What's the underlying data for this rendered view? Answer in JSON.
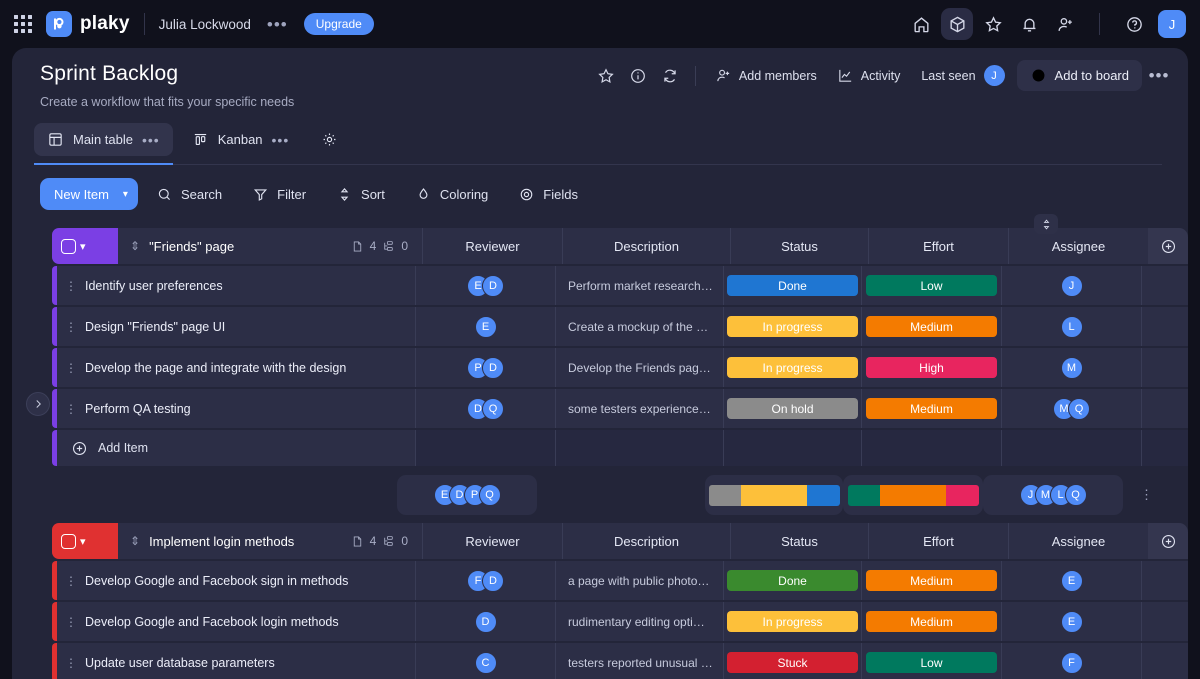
{
  "topnav": {
    "apps_icon": "grid-apps-icon",
    "logo_text": "plaky",
    "user_name": "Julia Lockwood",
    "more_label": "•••",
    "upgrade_label": "Upgrade",
    "icons": [
      "home-icon",
      "cube-icon",
      "star-icon",
      "bell-icon",
      "add-user-icon",
      "help-icon"
    ],
    "avatar_initial": "J",
    "accent": "#4f8bf7"
  },
  "board": {
    "title": "Sprint Backlog",
    "subtitle": "Create a workflow that fits your specific needs",
    "actions": {
      "star": "star-icon",
      "info": "info-icon",
      "refresh": "activity-refresh-icon",
      "add_members": "Add members",
      "activity": "Activity",
      "last_seen": "Last seen",
      "last_seen_avatar": "J",
      "add_to_board": "Add to board",
      "more": "•••"
    },
    "tabs": [
      {
        "label": "Main table",
        "icon": "table-icon",
        "selected": true,
        "menu": "•••"
      },
      {
        "label": "Kanban",
        "icon": "kanban-icon",
        "selected": false,
        "menu": "•••"
      }
    ],
    "settings_icon": "gear-icon"
  },
  "toolbar": {
    "new_item": "New Item",
    "new_item_caret": "▾",
    "buttons": [
      {
        "label": "Search",
        "icon": "search-icon"
      },
      {
        "label": "Filter",
        "icon": "filter-icon"
      },
      {
        "label": "Sort",
        "icon": "sort-icon"
      },
      {
        "label": "Coloring",
        "icon": "coloring-drop-icon"
      },
      {
        "label": "Fields",
        "icon": "eye-fields-icon"
      }
    ],
    "sort_toggle_icon": "sort-updown-icon"
  },
  "columns": [
    "Reviewer",
    "Description",
    "Status",
    "Effort",
    "Assignee"
  ],
  "add_item_label": "Add Item",
  "groups": [
    {
      "title": "\"Friends\" page",
      "color": "#7b3fe4",
      "badge_color": "#7b3fe4",
      "doc_count": "4",
      "sub_count": "0",
      "rows": [
        {
          "name": "Identify user preferences",
          "reviewers": [
            "E",
            "D"
          ],
          "description": "Perform market research…",
          "status": {
            "label": "Done",
            "color": "#1f76d2"
          },
          "effort": {
            "label": "Low",
            "color": "#00795e"
          },
          "assignees": [
            "J"
          ]
        },
        {
          "name": "Design \"Friends\" page UI",
          "reviewers": [
            "E"
          ],
          "description": "Create a mockup of the …",
          "status": {
            "label": "In progress",
            "color": "#fdc03a"
          },
          "effort": {
            "label": "Medium",
            "color": "#f47b00"
          },
          "assignees": [
            "L"
          ]
        },
        {
          "name": "Develop the page and integrate with the design",
          "reviewers": [
            "P",
            "D"
          ],
          "description": "Develop the Friends pag…",
          "status": {
            "label": "In progress",
            "color": "#fdc03a"
          },
          "effort": {
            "label": "High",
            "color": "#e8255f"
          },
          "assignees": [
            "M"
          ]
        },
        {
          "name": "Perform QA testing",
          "reviewers": [
            "D",
            "Q"
          ],
          "description": "some testers experience…",
          "status": {
            "label": "On hold",
            "color": "#8b8b8b"
          },
          "effort": {
            "label": "Medium",
            "color": "#f47b00"
          },
          "assignees": [
            "M",
            "Q"
          ]
        }
      ],
      "summary": {
        "reviewers": [
          "E",
          "D",
          "P",
          "Q"
        ],
        "status_stack": [
          {
            "color": "#8b8b8b",
            "pct": 25
          },
          {
            "color": "#fdc03a",
            "pct": 50
          },
          {
            "color": "#1f76d2",
            "pct": 25
          }
        ],
        "effort_stack": [
          {
            "color": "#00795e",
            "pct": 25
          },
          {
            "color": "#f47b00",
            "pct": 50
          },
          {
            "color": "#e8255f",
            "pct": 25
          }
        ],
        "assignees": [
          "J",
          "M",
          "L",
          "Q"
        ],
        "more": "⋮"
      }
    },
    {
      "title": "Implement login methods",
      "color": "#e03131",
      "badge_color": "#e03131",
      "doc_count": "4",
      "sub_count": "0",
      "rows": [
        {
          "name": "Develop Google and Facebook sign in methods",
          "reviewers": [
            "F",
            "D"
          ],
          "description": "a page with public photo…",
          "status": {
            "label": "Done",
            "color": "#3a8a2e"
          },
          "effort": {
            "label": "Medium",
            "color": "#f47b00"
          },
          "assignees": [
            "E"
          ]
        },
        {
          "name": "Develop Google and Facebook login methods",
          "reviewers": [
            "D"
          ],
          "description": "rudimentary editing opti…",
          "status": {
            "label": "In progress",
            "color": "#fdc03a"
          },
          "effort": {
            "label": "Medium",
            "color": "#f47b00"
          },
          "assignees": [
            "E"
          ]
        },
        {
          "name": "Update user database parameters",
          "reviewers": [
            "C"
          ],
          "description": "testers reported unusual …",
          "status": {
            "label": "Stuck",
            "color": "#d32030"
          },
          "effort": {
            "label": "Low",
            "color": "#00795e"
          },
          "assignees": [
            "F"
          ]
        }
      ]
    }
  ]
}
